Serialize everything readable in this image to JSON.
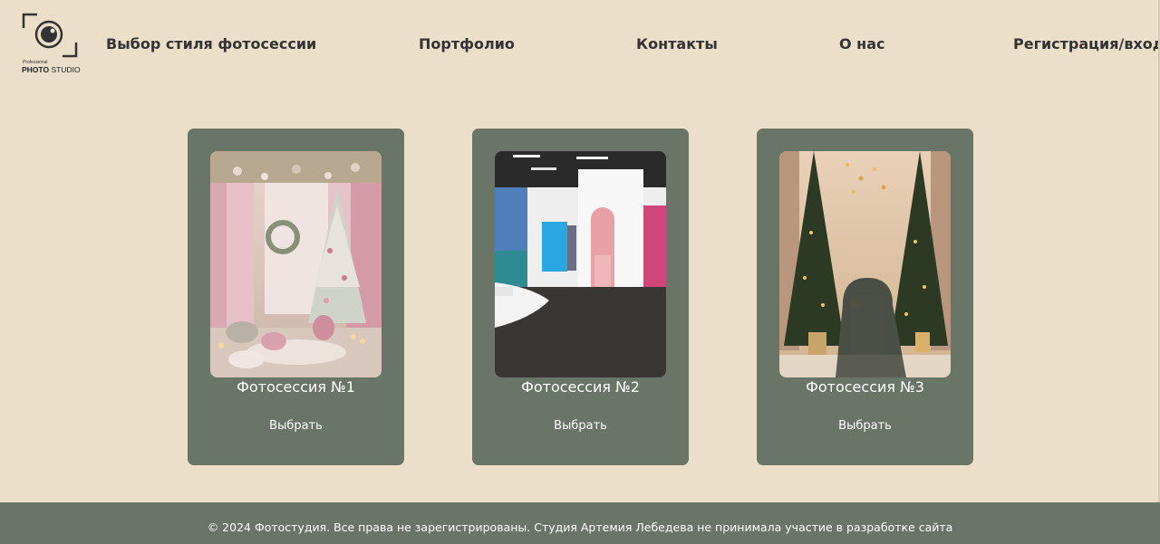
{
  "logo": {
    "small_text": "Professional",
    "brand_bold": "PHOTO",
    "brand_rest": " STUDIO"
  },
  "nav": {
    "items": [
      {
        "label": "Выбор стиля фотосессии"
      },
      {
        "label": "Портфолио"
      },
      {
        "label": "Контакты"
      },
      {
        "label": "О нас"
      },
      {
        "label": "Регистрация/вход"
      }
    ]
  },
  "cards": [
    {
      "title": "Фотосессия №1",
      "button": "Выбрать"
    },
    {
      "title": "Фотосессия №2",
      "button": "Выбрать"
    },
    {
      "title": "Фотосессия №3",
      "button": "Выбрать"
    }
  ],
  "footer": {
    "text": "© 2024 Фотостудия. Все права не зарегистрированы. Студия Артемия Лебедева не принимала участие в разработке сайта"
  },
  "colors": {
    "background": "#ecdfca",
    "card": "#697566",
    "footer": "#697566",
    "text_dark": "#333333",
    "text_light": "#ffffff"
  }
}
